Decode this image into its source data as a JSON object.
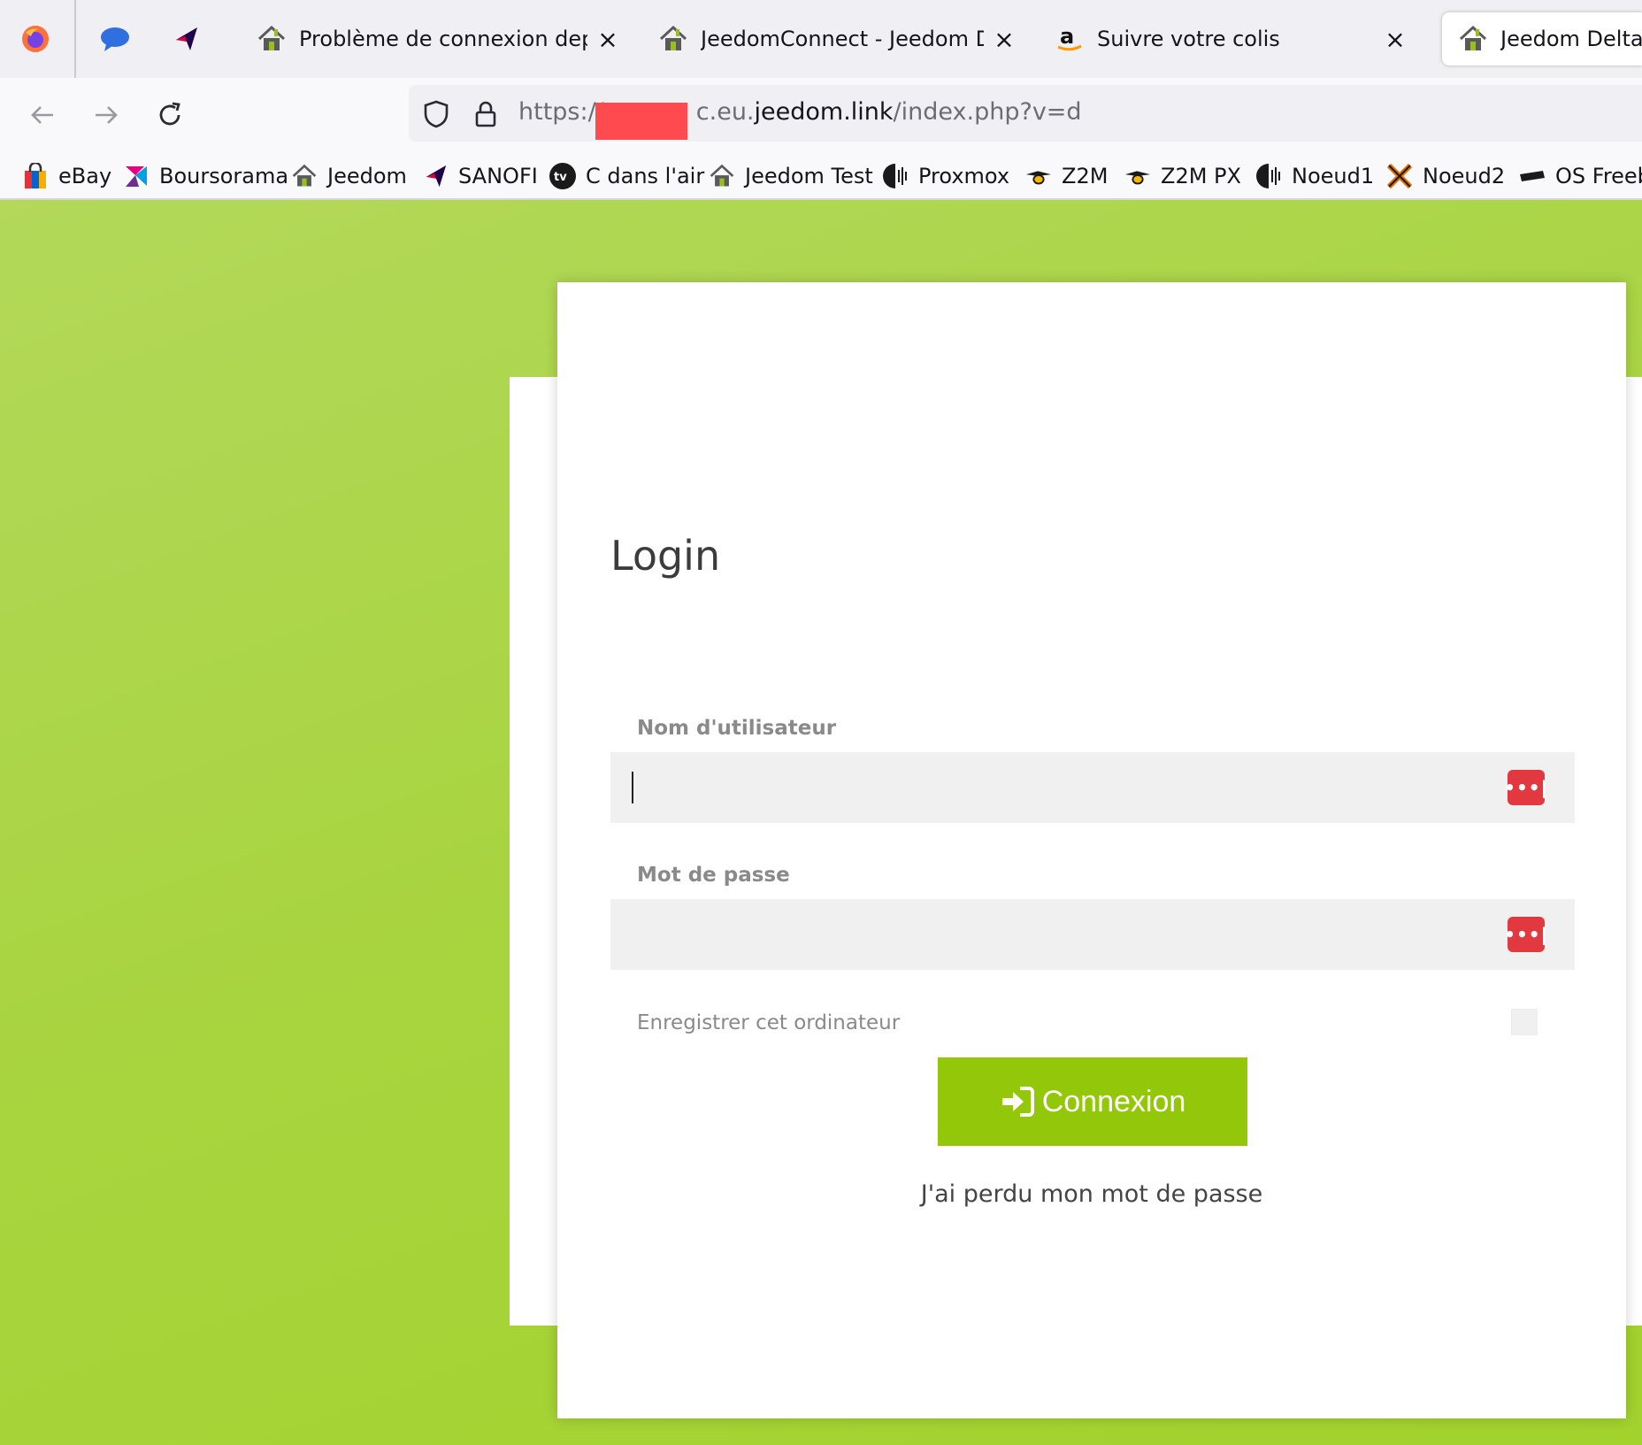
{
  "browser": {
    "tabs": [
      {
        "label": "Problème de connexion depuis",
        "active": false
      },
      {
        "label": "JeedomConnect - Jeedom Delta",
        "active": false
      },
      {
        "label": "Suivre votre colis",
        "active": false
      },
      {
        "label": "Jeedom Delta -",
        "active": true
      }
    ],
    "close_glyph": "×",
    "url": {
      "scheme": "https://",
      "host_partial": "c.eu.",
      "host_domain": "jeedom.link",
      "path": "/index.php?v=d"
    },
    "bookmarks": [
      {
        "label": "eBay",
        "icon": "shopping-bag-icon"
      },
      {
        "label": "Boursorama",
        "icon": "boursorama-logo-icon"
      },
      {
        "label": "Jeedom",
        "icon": "jeedom-house-icon"
      },
      {
        "label": "SANOFI",
        "icon": "sanofi-logo-icon"
      },
      {
        "label": "C dans l'air",
        "icon": "tv-logo-icon"
      },
      {
        "label": "Jeedom Test",
        "icon": "jeedom-house-icon"
      },
      {
        "label": "Proxmox",
        "icon": "server-icon"
      },
      {
        "label": "Z2M",
        "icon": "zigbee-bee-icon"
      },
      {
        "label": "Z2M PX",
        "icon": "zigbee-bee-icon"
      },
      {
        "label": "Noeud1",
        "icon": "server-icon"
      },
      {
        "label": "Noeud2",
        "icon": "proxmox-x-icon"
      },
      {
        "label": "OS Freeb",
        "icon": "router-icon"
      }
    ]
  },
  "login": {
    "title": "Login",
    "username_label": "Nom d'utilisateur",
    "username_value": "",
    "password_label": "Mot de passe",
    "password_value": "",
    "password_manager_glyph": "•••|",
    "remember_label": "Enregistrer cet ordinateur",
    "remember_checked": false,
    "submit_label": "Connexion",
    "lost_password": "J'ai perdu mon mot de passe"
  },
  "colors": {
    "background": "#a9d63a",
    "accent": "#93c80a",
    "password_manager": "#e2383f"
  }
}
